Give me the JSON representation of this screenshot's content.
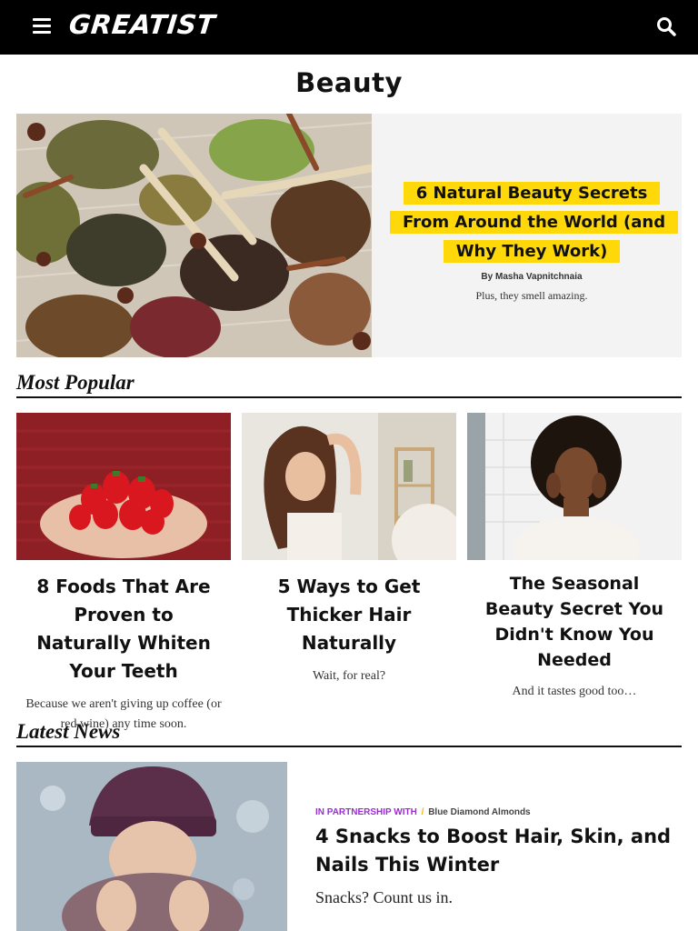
{
  "header": {
    "logo": "GREATIST",
    "menu_icon": "hamburger-menu-icon",
    "search_icon": "search-icon",
    "bg_color": "#000000"
  },
  "page": {
    "title": "Beauty"
  },
  "hero": {
    "title": "6 Natural Beauty Secrets From Around the World (and Why They Work)",
    "byline_prefix": "By",
    "author": "Masha Vapnitchnaia",
    "dek": "Plus, they smell amazing.",
    "highlight_color": "#ffd80a"
  },
  "most_popular": {
    "heading": "Most Popular",
    "cards": [
      {
        "title": "8 Foods That Are Proven to Naturally Whiten Your Teeth",
        "dek": "Because we aren't giving up coffee (or red wine) any time soon."
      },
      {
        "title": "5 Ways to Get Thicker Hair Naturally",
        "dek": "Wait, for real?"
      },
      {
        "title": "The Seasonal Beauty Secret You Didn't Know You Needed",
        "dek": "And it tastes good too…"
      }
    ]
  },
  "latest_news": {
    "heading": "Latest News",
    "items": [
      {
        "sponsor_tag": "IN PARTNERSHIP WITH",
        "sponsor_sep": "/",
        "sponsor_brand": "Blue Diamond Almonds",
        "title": "4 Snacks to Boost Hair, Skin, and Nails This Winter",
        "dek": "Snacks? Count us in."
      }
    ]
  }
}
